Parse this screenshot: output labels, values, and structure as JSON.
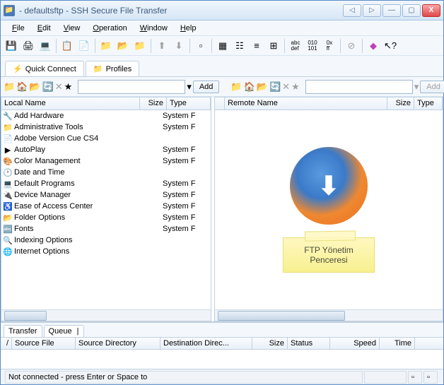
{
  "title": " - defaultsftp - SSH Secure File Transfer",
  "menu": [
    "File",
    "Edit",
    "View",
    "Operation",
    "Window",
    "Help"
  ],
  "quick_connect": "Quick Connect",
  "profiles": "Profiles",
  "add_button": "Add",
  "local": {
    "headers": {
      "name": "Local Name",
      "size": "Size",
      "type": "Type"
    },
    "files": [
      {
        "name": "Add Hardware",
        "type": "System F",
        "icon": "🔧"
      },
      {
        "name": "Administrative Tools",
        "type": "System F",
        "icon": "📁"
      },
      {
        "name": "Adobe Version Cue CS4",
        "type": "",
        "icon": "📄"
      },
      {
        "name": "AutoPlay",
        "type": "System F",
        "icon": "▶"
      },
      {
        "name": "Color Management",
        "type": "System F",
        "icon": "🎨"
      },
      {
        "name": "Date and Time",
        "type": "",
        "icon": "🕐"
      },
      {
        "name": "Default Programs",
        "type": "System F",
        "icon": "💻"
      },
      {
        "name": "Device Manager",
        "type": "System F",
        "icon": "🔌"
      },
      {
        "name": "Ease of Access Center",
        "type": "System F",
        "icon": "♿"
      },
      {
        "name": "Folder Options",
        "type": "System F",
        "icon": "📂"
      },
      {
        "name": "Fonts",
        "type": "System F",
        "icon": "🔤"
      },
      {
        "name": "Indexing Options",
        "type": "",
        "icon": "🔍"
      },
      {
        "name": "Internet Options",
        "type": "",
        "icon": "🌐"
      }
    ]
  },
  "remote": {
    "headers": {
      "name": "Remote Name",
      "size": "Size",
      "type": "Type"
    },
    "sticky_note": "FTP Yönetim Penceresi"
  },
  "transfer": {
    "tab_transfer": "Transfer",
    "tab_queue": "Queue",
    "headers": [
      "/",
      "Source File",
      "Source Directory",
      "Destination Direc...",
      "Size",
      "Status",
      "Speed",
      "Time"
    ]
  },
  "status": "Not connected - press Enter or Space to"
}
